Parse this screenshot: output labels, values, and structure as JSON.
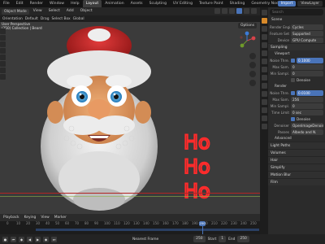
{
  "topbar": {
    "menus": [
      "File",
      "Edit",
      "Render",
      "Window",
      "Help"
    ],
    "workspaces": [
      "Layout",
      "Animation",
      "Assets",
      "Sculpting",
      "UV Editing",
      "Texture Paint",
      "Shading",
      "Geometry Nodes"
    ],
    "active_workspace": "Layout",
    "import_label": "Import",
    "view_layer_label": "ViewLayer"
  },
  "viewport_header": {
    "mode": "Object Mode",
    "menus": [
      "View",
      "Select",
      "Add",
      "Object"
    ],
    "orientation": "Global"
  },
  "toolrow": {
    "items": [
      "Orientation",
      "Default",
      "Drag",
      "Select Box"
    ]
  },
  "viewport": {
    "hud_line1": "User Perspective",
    "hud_line2": "(250) Collection | Beard",
    "options_label": "Options",
    "hoho_text": [
      "Ho",
      "Ho",
      "Ho"
    ]
  },
  "timeline": {
    "menus": [
      "Playback",
      "Keying",
      "View",
      "Marker"
    ],
    "ticks": [
      "0",
      "10",
      "20",
      "30",
      "40",
      "50",
      "60",
      "70",
      "80",
      "90",
      "100",
      "110",
      "120",
      "130",
      "140",
      "150",
      "160",
      "170",
      "180",
      "190",
      "200",
      "210",
      "220",
      "230",
      "240",
      "250"
    ],
    "current_frame": "250",
    "start_label": "Start",
    "start_value": "1",
    "end_label": "End",
    "end_value": "250",
    "keying_set": "Nearest Frame"
  },
  "properties": {
    "search_placeholder": "Search",
    "scene_label": "Scene",
    "render_engine_label": "Render Engi.",
    "render_engine_value": "Cycles",
    "feature_set_label": "Feature Set",
    "feature_set_value": "Supported",
    "device_label": "Device",
    "device_value": "GPU Compute",
    "sampling_section": "Sampling",
    "viewport_section": "Viewport",
    "noise_thresh_label": "Noise Thre.",
    "noise_thresh_value": "0.1000",
    "max_samples_label": "Max Sam.",
    "max_samples_value": "0",
    "min_samples_label": "Min Sampl.",
    "min_samples_value": "0",
    "denoise_label": "Denoise",
    "render_section": "Render",
    "r_noise_thresh_label": "Noise Thre.",
    "r_noise_thresh_value": "0.0100",
    "r_max_samples_label": "Max Sam.",
    "r_max_samples_value": "256",
    "r_min_samples_label": "Min Sampl.",
    "r_min_samples_value": "0",
    "time_limit_label": "Time Limit",
    "time_limit_value": "0 sec",
    "r_denoise_label": "Denoise",
    "denoiser_label": "Denoiser",
    "denoiser_value": "OpenImageDenoise",
    "passes_label": "Passes",
    "passes_value": "Albedo and N.",
    "advanced_section": "Advanced",
    "light_paths_section": "Light Paths",
    "volumes_section": "Volumes",
    "hair_section": "Hair",
    "simplify_section": "Simplify",
    "motion_blur_section": "Motion Blur",
    "film_section": "Film"
  }
}
